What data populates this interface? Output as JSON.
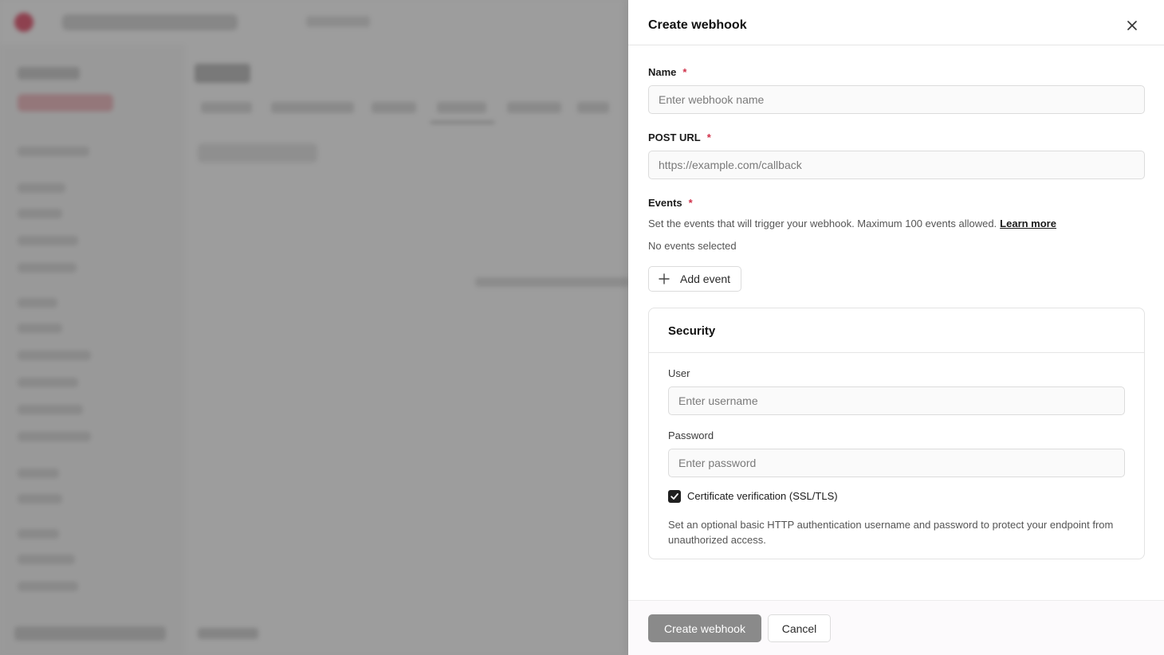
{
  "drawer": {
    "title": "Create webhook",
    "close_icon": "close-icon"
  },
  "form": {
    "name": {
      "label": "Name",
      "required_mark": "*",
      "placeholder": "Enter webhook name",
      "value": ""
    },
    "post_url": {
      "label": "POST URL",
      "required_mark": "*",
      "placeholder": "https://example.com/callback",
      "value": ""
    },
    "events": {
      "label": "Events",
      "required_mark": "*",
      "description": "Set the events that will trigger your webhook. Maximum 100 events allowed.",
      "learn_more": "Learn more",
      "empty_text": "No events selected",
      "add_button": "Add event",
      "add_icon": "plus-icon"
    }
  },
  "security": {
    "title": "Security",
    "user": {
      "label": "User",
      "placeholder": "Enter username",
      "value": ""
    },
    "password": {
      "label": "Password",
      "placeholder": "Enter password",
      "value": ""
    },
    "cert_verification": {
      "label": "Certificate verification (SSL/TLS)",
      "checked": true
    },
    "help": "Set an optional basic HTTP authentication username and password to protect your endpoint from unauthorized access."
  },
  "footer": {
    "submit": "Create webhook",
    "cancel": "Cancel"
  },
  "colors": {
    "required": "#d0314a",
    "primary_button_disabled": "#8a8a8a",
    "overlay": "rgba(80,80,80,0.55)",
    "brand": "#d9304f"
  }
}
